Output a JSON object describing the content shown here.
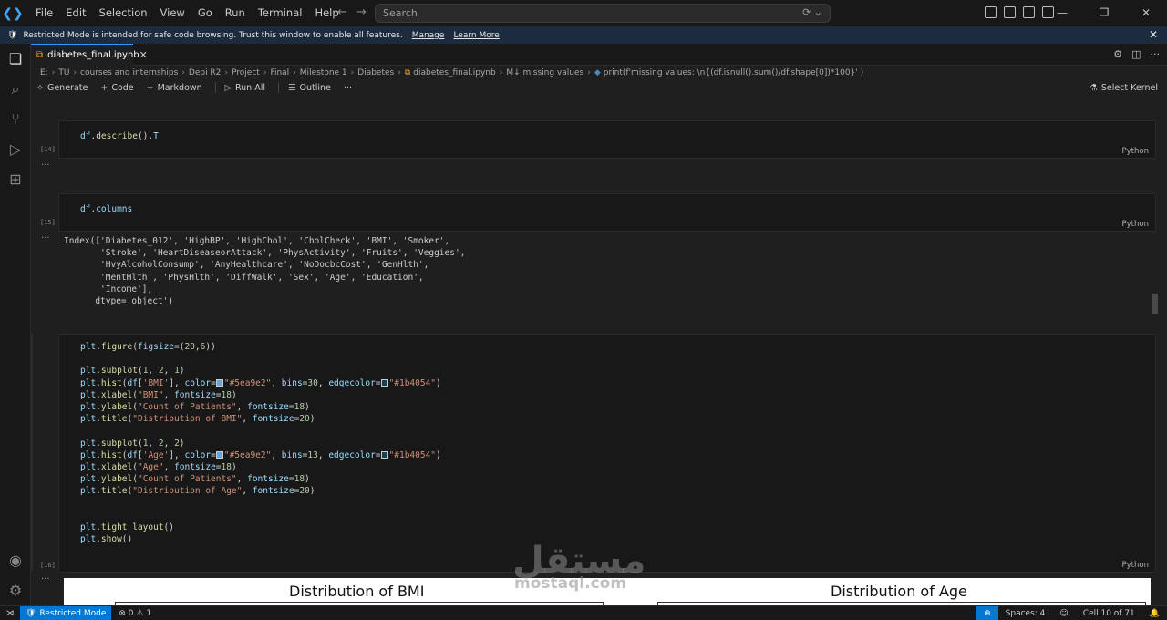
{
  "titlebar": {
    "menu": [
      "File",
      "Edit",
      "Selection",
      "View",
      "Go",
      "Run",
      "Terminal",
      "Help"
    ],
    "search_placeholder": "Search"
  },
  "banner": {
    "message": "Restricted Mode is intended for safe code browsing. Trust this window to enable all features.",
    "manage": "Manage",
    "learn_more": "Learn More"
  },
  "tab": {
    "filename": "diabetes_final.ipynb"
  },
  "breadcrumb": [
    "E:",
    "TU",
    "courses and internships",
    "Depi R2",
    "Project",
    "Final",
    "Milestone 1",
    "Diabetes",
    "diabetes_final.ipynb",
    "M↓ missing values",
    "print(f'missing values: \\n{(df.isnull().sum()/df.shape[0])*100}' )"
  ],
  "toolbar": {
    "generate": "Generate",
    "code": "Code",
    "markdown": "Markdown",
    "run_all": "Run All",
    "outline": "Outline",
    "more": "···",
    "select_kernel": "Select Kernel"
  },
  "cells": {
    "c14": {
      "exec": "[14]",
      "lang": "Python"
    },
    "c15": {
      "exec": "[15]",
      "lang": "Python"
    },
    "c16": {
      "exec": "[16]",
      "lang": "Python"
    }
  },
  "output15": {
    "lines": [
      "Index(['Diabetes_012', 'HighBP', 'HighChol', 'CholCheck', 'BMI', 'Smoker',",
      "       'Stroke', 'HeartDiseaseorAttack', 'PhysActivity', 'Fruits', 'Veggies',",
      "       'HvyAlcoholConsump', 'AnyHealthcare', 'NoDocbcCost', 'GenHlth',",
      "       'MentHlth', 'PhysHlth', 'DiffWalk', 'Sex', 'Age', 'Education',",
      "       'Income'],",
      "      dtype='object')"
    ]
  },
  "plot": {
    "title_left": "Distribution of BMI",
    "title_right": "Distribution of Age"
  },
  "watermark": {
    "arabic": "مستقل",
    "latin": "mostaql.com"
  },
  "statusbar": {
    "restricted": "Restricted Mode",
    "errors": "0",
    "warnings": "1",
    "spaces": "Spaces: 4",
    "cell": "Cell 10 of 71"
  },
  "colors": {
    "accent": "#0078d4",
    "banner_bg": "#1c2b3d",
    "editor_bg": "#1f1f1f",
    "hist_color": "#5ea9e2",
    "edge_color": "#1b4054"
  }
}
